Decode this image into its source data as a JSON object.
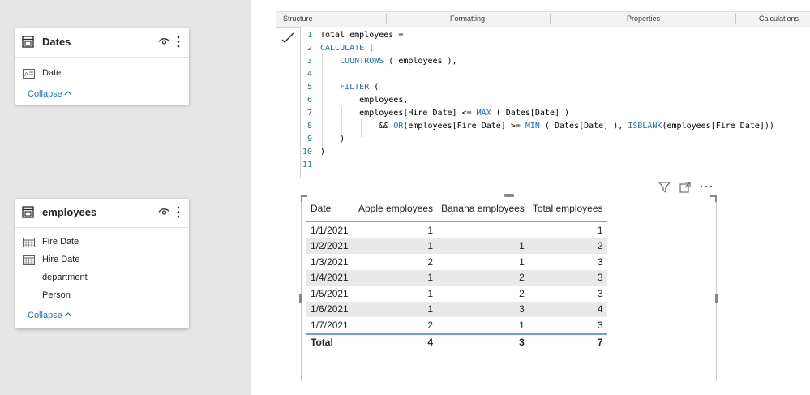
{
  "model_view": {
    "tables": [
      {
        "name": "Dates",
        "fields": [
          {
            "label": "Date",
            "icon": "text-field-icon"
          }
        ],
        "collapse_label": "Collapse"
      },
      {
        "name": "employees",
        "fields": [
          {
            "label": "Fire Date",
            "icon": "calendar-icon"
          },
          {
            "label": "Hire Date",
            "icon": "calendar-icon"
          },
          {
            "label": "department",
            "icon": ""
          },
          {
            "label": "Person",
            "icon": ""
          }
        ],
        "collapse_label": "Collapse"
      }
    ]
  },
  "ribbon": {
    "tabs": [
      "Structure",
      "Formatting",
      "Properties",
      "Calculations"
    ]
  },
  "formula_editor": {
    "lines": [
      {
        "num": "1",
        "text": "Total employees ="
      },
      {
        "num": "2",
        "text": "CALCULATE ("
      },
      {
        "num": "3",
        "text": "    COUNTROWS ( employees ),"
      },
      {
        "num": "4",
        "text": ""
      },
      {
        "num": "5",
        "text": "    FILTER ("
      },
      {
        "num": "6",
        "text": "        employees,"
      },
      {
        "num": "7",
        "text": "        employees[Hire Date] <= MAX ( Dates[Date] )"
      },
      {
        "num": "8",
        "text": "            && OR(employees[Fire Date] >= MIN ( Dates[Date] ), ISBLANK(employees[Fire Date]))"
      },
      {
        "num": "9",
        "text": "    )"
      },
      {
        "num": "10",
        "text": ")"
      },
      {
        "num": "11",
        "text": ""
      }
    ],
    "keyword_color": "#1e6fc1",
    "line_number_color": "#237893"
  },
  "visual": {
    "toolbar_icons": [
      "filter-icon",
      "focus-mode-icon",
      "more-options-icon"
    ],
    "matrix": {
      "headers": [
        "Date",
        "Apple employees",
        "Banana employees",
        "Total employees"
      ],
      "rows": [
        [
          "1/1/2021",
          "1",
          "",
          "1"
        ],
        [
          "1/2/2021",
          "1",
          "1",
          "2"
        ],
        [
          "1/3/2021",
          "2",
          "1",
          "3"
        ],
        [
          "1/4/2021",
          "1",
          "2",
          "3"
        ],
        [
          "1/5/2021",
          "1",
          "2",
          "3"
        ],
        [
          "1/6/2021",
          "1",
          "3",
          "4"
        ],
        [
          "1/7/2021",
          "2",
          "1",
          "3"
        ]
      ],
      "total": [
        "Total",
        "4",
        "3",
        "7"
      ]
    },
    "accent_color": "#6ba3d8"
  }
}
